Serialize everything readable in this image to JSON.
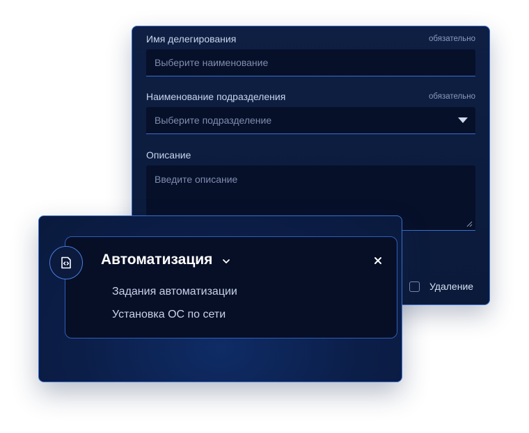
{
  "delegation_form": {
    "name_field": {
      "label": "Имя делегирования",
      "required_text": "обязательно",
      "placeholder": "Выберите наименование"
    },
    "department_field": {
      "label": "Наименование подразделения",
      "required_text": "обязательно",
      "placeholder": "Выберите подразделение"
    },
    "description_field": {
      "label": "Описание",
      "placeholder": "Введите описание"
    },
    "delete_checkbox": {
      "label": "Удаление",
      "checked": false
    }
  },
  "automation_menu": {
    "title": "Автоматизация",
    "icon": "code-file-icon",
    "items": [
      {
        "label": "Задания автоматизации"
      },
      {
        "label": "Установка ОС по сети"
      }
    ]
  },
  "colors": {
    "panel_bg": "#0e1f43",
    "input_bg": "#071029",
    "accent_border": "#3a6fd0",
    "text_primary": "#ffffff",
    "text_secondary": "#c9d5ec",
    "placeholder": "#7f8db0"
  }
}
